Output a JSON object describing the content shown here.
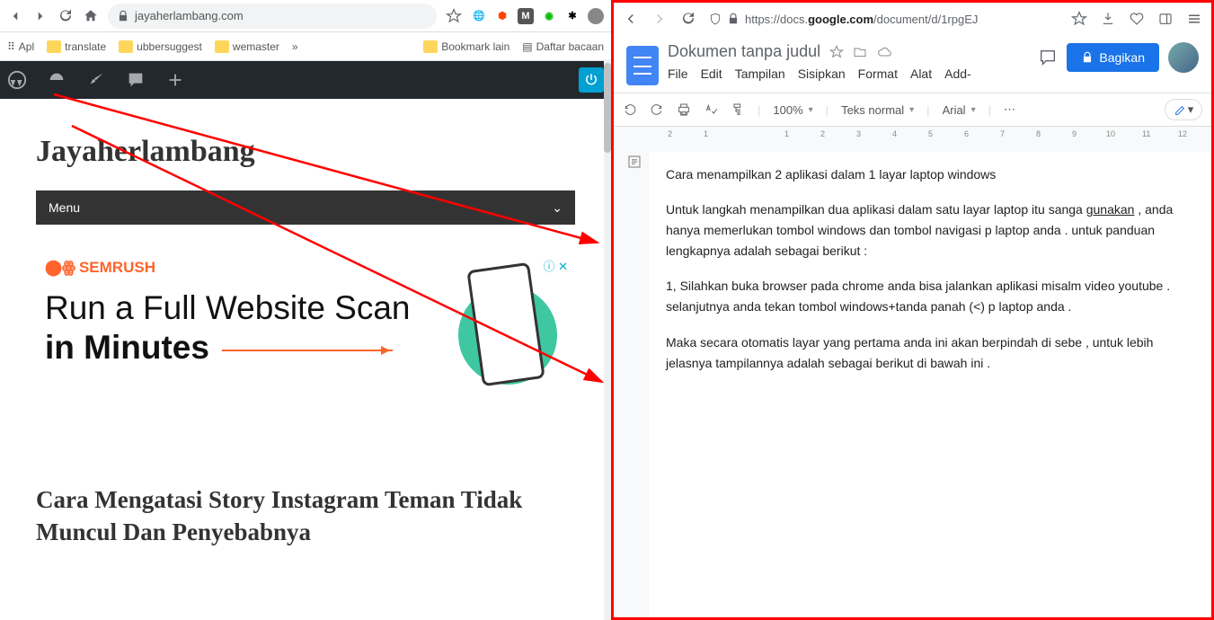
{
  "left": {
    "url": "jayaherlambang.com",
    "bookmarks": {
      "apl": "Apl",
      "translate": "translate",
      "ubber": "ubbersuggest",
      "wemaster": "wemaster",
      "bmlain": "Bookmark lain",
      "daftar": "Daftar bacaan"
    },
    "site_title": "Jayaherlambang",
    "menu": "Menu",
    "ad": {
      "brand": "SEMRUSH",
      "line1": "Run a Full Website Scan",
      "line2": "in Minutes"
    },
    "article": "Cara Mengatasi Story Instagram Teman Tidak Muncul Dan Penyebabnya"
  },
  "right": {
    "url_prefix": "https://docs.",
    "url_bold": "google.com",
    "url_rest": "/document/d/1rpgEJ",
    "doc_title": "Dokumen tanpa judul",
    "menus": {
      "file": "File",
      "edit": "Edit",
      "tampilan": "Tampilan",
      "sisipkan": "Sisipkan",
      "format": "Format",
      "alat": "Alat",
      "add": "Add-"
    },
    "share": "Bagikan",
    "toolbar": {
      "zoom": "100%",
      "style": "Teks normal",
      "font": "Arial"
    },
    "content": {
      "p1": "Cara menampilkan 2 aplikasi dalam 1 layar laptop windows",
      "p2a": "Untuk langkah menampilkan dua aplikasi dalam satu layar laptop itu sanga",
      "p2u": "gunakan",
      "p2b": " , anda hanya memerlukan tombol windows dan tombol navigasi p laptop anda . untuk panduan lengkapnya adalah sebagai berikut :",
      "p3": "1, Silahkan buka browser pada chrome anda bisa jalankan aplikasi misalm video youtube . selanjutnya anda tekan tombol windows+tanda panah (<) p laptop anda .",
      "p4": "Maka secara otomatis layar yang pertama anda ini akan berpindah di sebe , untuk lebih jelasnya tampilannya adalah sebagai berikut di bawah ini ."
    }
  },
  "ruler": {
    "n2": "2",
    "n1": "1",
    "p1": "1",
    "p2": "2",
    "p3": "3",
    "p4": "4",
    "p5": "5",
    "p6": "6",
    "p7": "7",
    "p8": "8",
    "p9": "9",
    "p10": "10",
    "p11": "11",
    "p12": "12"
  }
}
